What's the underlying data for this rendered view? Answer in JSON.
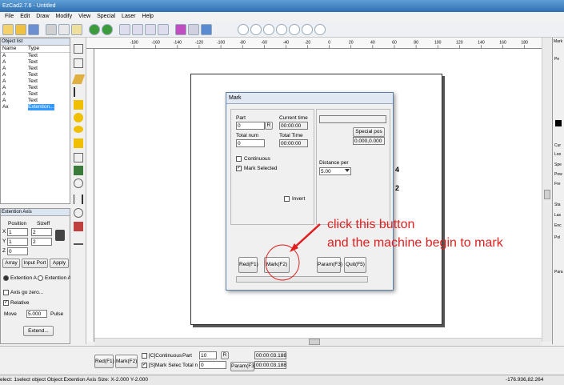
{
  "window": {
    "title": "EzCad2.7.6 - Untitled"
  },
  "menu": [
    "File",
    "Edit",
    "Draw",
    "Modify",
    "View",
    "Special",
    "Laser",
    "Help"
  ],
  "object_list": {
    "title": "Object list",
    "headers": [
      "Name",
      "Type"
    ],
    "rows": [
      {
        "name": "A",
        "type": "Text"
      },
      {
        "name": "A",
        "type": "Text"
      },
      {
        "name": "A",
        "type": "Text"
      },
      {
        "name": "A",
        "type": "Text"
      },
      {
        "name": "A",
        "type": "Text"
      },
      {
        "name": "A",
        "type": "Text"
      },
      {
        "name": "A",
        "type": "Text"
      },
      {
        "name": "A",
        "type": "Text"
      },
      {
        "name": "Ax",
        "type": "Extention..."
      }
    ]
  },
  "ext_axis": {
    "title": "Extention Axis",
    "position_label": "Position",
    "size_label": "Sizeff",
    "x_label": "X",
    "x_pos": "1",
    "x_size": "2",
    "y_label": "Y",
    "y_pos": "1",
    "y_size": "2",
    "z_label": "Z",
    "z_pos": "0",
    "array_btn": "Array",
    "input_port_btn": "Input Port",
    "apply_btn": "Apply",
    "ext_a": "Extention A",
    "ext_a2": "Extention A",
    "axis_zero": "Axis go zero...",
    "relative": "Relative",
    "move_label": "Move",
    "move_value": "5.000",
    "pulse_label": "Pulse",
    "extend_btn": "Extend..."
  },
  "ruler_labels": [
    "-180",
    "-160",
    "-140",
    "-120",
    "-100",
    "-80",
    "-60",
    "-40",
    "-20",
    "0",
    "20",
    "40",
    "60",
    "80",
    "100",
    "120",
    "140",
    "160",
    "180"
  ],
  "canvas_side": [
    "4",
    "2"
  ],
  "mark_dialog": {
    "title": "Mark",
    "part_label": "Part",
    "part_value": "0",
    "r_btn": "R",
    "current_time_label": "Current time",
    "current_time": "00:00:00",
    "total_num_label": "Total num",
    "total_num": "0",
    "total_time_label": "Total Time",
    "total_time": "00:00:00",
    "special_pos_btn": "Special pos",
    "special_pos_value": "0.000,0.000",
    "continuous": "Continuous",
    "mark_selected": "Mark Selected",
    "distance_label": "Distance per",
    "distance_value": "5.00",
    "invert": "Invert",
    "red_btn": "Red(F1)",
    "mark_btn": "Mark(F2)",
    "param_btn": "Param(F3)",
    "quit_btn": "Quit(F5)"
  },
  "annotation": {
    "line1": "click this button",
    "line2": "and the machine begin to mark"
  },
  "bottom": {
    "red_btn": "Red(F1)",
    "mark_btn": "Mark(F2)",
    "continuous": "[C]Continuous",
    "part_label": "Part",
    "part_value": "10",
    "r_btn": "R",
    "time1": "00:00:03.188",
    "mark_select": "[S]Mark Selec",
    "total_label": "Total n",
    "total_value": "0",
    "param_btn": "Param(F3)",
    "time2": "00:00:03.188"
  },
  "status": {
    "text": "elect: 1select object Object:Extention Axis Size: X-2.000 Y-2.000",
    "coords": "-176.936,82.264"
  },
  "right_panel": {
    "title": "Mark",
    "items": [
      "Pe",
      "Cur",
      "Loo",
      "Spe",
      "Pow",
      "Fre",
      "Sta",
      "Las",
      "Enc",
      "Pol",
      "Para"
    ]
  },
  "colors": {
    "selection": "#3399ff",
    "annotation": "#e02020",
    "titlebar": "#3a7cc0"
  }
}
